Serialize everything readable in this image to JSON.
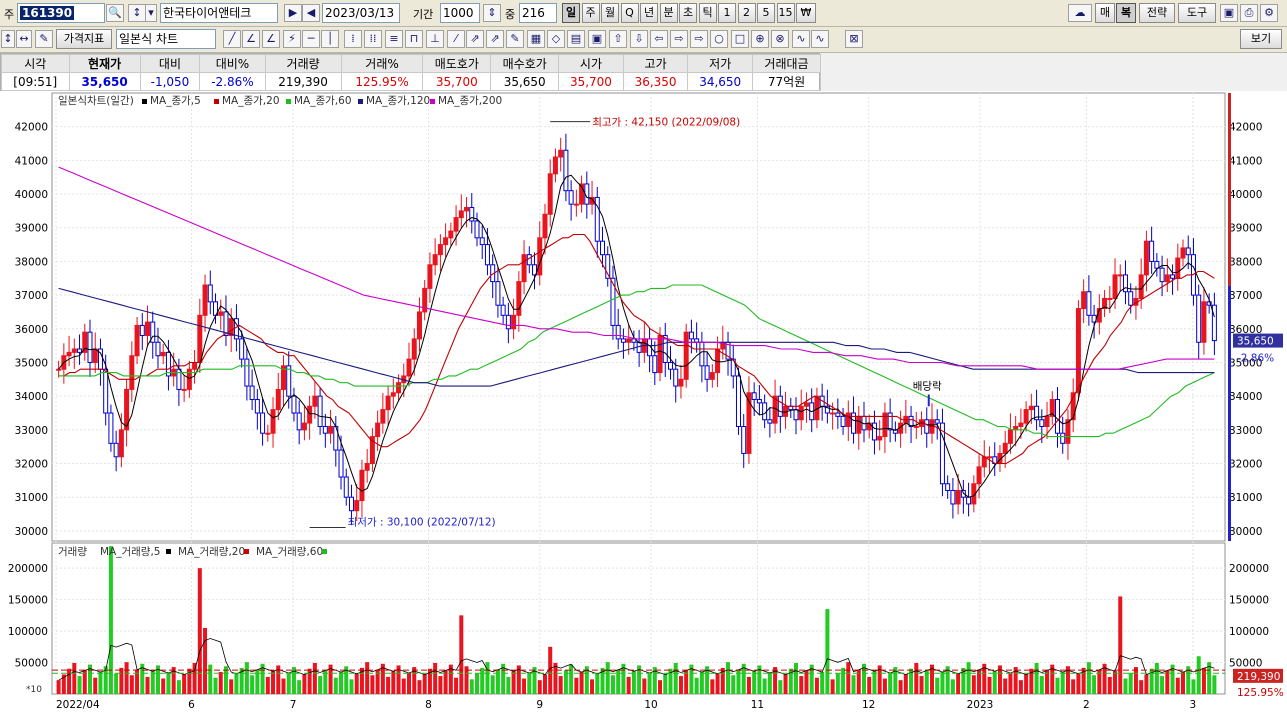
{
  "toolbar": {
    "code_prefix": "주",
    "code": "161390",
    "stock_name": "한국타이어앤테크",
    "date": "2023/03/13",
    "period_label": "기간",
    "period_value": "1000",
    "count_label": "중",
    "count_value": "216",
    "timeframes": [
      "일",
      "주",
      "월",
      "Q",
      "년",
      "분",
      "초",
      "틱",
      "1",
      "2",
      "5",
      "15",
      "₩"
    ],
    "active_timeframe": "일",
    "right_buttons": [
      "매",
      "복",
      "전략",
      "도구"
    ],
    "indicator_button": "가격지표",
    "chart_type": "일본식 차트",
    "view_button": "보기"
  },
  "quote": {
    "headers": [
      "시각",
      "현재가",
      "대비",
      "대비%",
      "거래량",
      "거래%",
      "매도호가",
      "매수호가",
      "시가",
      "고가",
      "저가",
      "거래대금"
    ],
    "values": [
      "[09:51]",
      "35,650",
      "-1,050",
      "-2.86%",
      "219,390",
      "125.95%",
      "35,700",
      "35,650",
      "35,700",
      "36,350",
      "34,650",
      "77억원"
    ]
  },
  "colors": {
    "up": "#e8141e",
    "down": "#0000cc",
    "ma5": "#000000",
    "ma20": "#c00000",
    "ma60": "#22bb22",
    "ma120": "#1a1a80",
    "ma200": "#cc00cc",
    "vol_up": "#e8141e",
    "vol_down": "#22cc22"
  },
  "chart_data": [
    {
      "type": "candlestick",
      "title": "일본식차트(일간)",
      "legend": [
        "MA_종가,5",
        "MA_종가,20",
        "MA_종가,60",
        "MA_종가,120",
        "MA_종가,200"
      ],
      "ylim": [
        29700,
        43000
      ],
      "yticks": [
        30000,
        31000,
        32000,
        33000,
        34000,
        35000,
        36000,
        37000,
        38000,
        39000,
        40000,
        41000,
        42000
      ],
      "xlabels": [
        "2022/04",
        "6",
        "7",
        "8",
        "9",
        "10",
        "11",
        "12",
        "2023",
        "2",
        "3"
      ],
      "last_price": "35,650",
      "last_change": "-2.86%",
      "annotations": [
        {
          "text": "최고가 : 42,150 (2022/09/08)",
          "value": 42150
        },
        {
          "text": "최저가 : 30,100 (2022/07/12)",
          "value": 30100
        },
        {
          "text": "배당락"
        }
      ],
      "closes": [
        34800,
        35200,
        35300,
        35400,
        35300,
        35900,
        35000,
        35400,
        34800,
        33500,
        32600,
        32200,
        33000,
        34200,
        35200,
        36100,
        35800,
        36200,
        35600,
        35200,
        35300,
        34600,
        34800,
        34200,
        34200,
        34800,
        35000,
        36400,
        37300,
        36800,
        36400,
        36500,
        35800,
        36300,
        35700,
        35100,
        34300,
        33900,
        33500,
        32900,
        32900,
        33600,
        34200,
        34900,
        34000,
        33500,
        33000,
        33200,
        33700,
        34000,
        33100,
        32900,
        33100,
        32400,
        31600,
        31000,
        30600,
        30900,
        31800,
        32000,
        32800,
        33200,
        33600,
        34000,
        34100,
        34400,
        34600,
        35100,
        35700,
        36500,
        37200,
        37900,
        38200,
        38500,
        38700,
        38900,
        39300,
        39500,
        39600,
        39200,
        38700,
        38500,
        37900,
        37400,
        36700,
        36400,
        36000,
        36400,
        37400,
        38200,
        37900,
        37600,
        38700,
        39400,
        40600,
        41100,
        41300,
        40100,
        39700,
        39700,
        40300,
        39700,
        39900,
        38600,
        38200,
        37500,
        36100,
        35700,
        35600,
        35700,
        35600,
        35300,
        35700,
        35200,
        34700,
        35800,
        35000,
        34800,
        34300,
        34500,
        35900,
        35700,
        35600,
        34900,
        34500,
        34700,
        35400,
        35600,
        35100,
        34600,
        33100,
        32300,
        34100,
        33900,
        33800,
        33300,
        33200,
        34000,
        33400,
        33700,
        33600,
        33300,
        33700,
        33800,
        33300,
        34000,
        33700,
        33500,
        33500,
        33400,
        33100,
        33500,
        32900,
        33400,
        33000,
        33200,
        32700,
        32800,
        33500,
        33000,
        32900,
        33200,
        33400,
        33100,
        33100,
        33300,
        32900,
        33300,
        33200,
        31400,
        31200,
        30800,
        31200,
        31000,
        30800,
        31400,
        31900,
        32200,
        32200,
        32000,
        32300,
        32600,
        33000,
        33100,
        33200,
        33600,
        33700,
        33300,
        33100,
        33400,
        33900,
        32900,
        32600,
        33300,
        34100,
        36600,
        37100,
        36400,
        36200,
        36600,
        36900,
        36900,
        37600,
        37600,
        37100,
        36700,
        36900,
        37600,
        38600,
        38000,
        37800,
        37400,
        37600,
        37500,
        38100,
        38400,
        38200,
        37000,
        35600,
        36800,
        36700,
        35650
      ],
      "ma20": [
        34600,
        34600,
        34700,
        34700,
        34800,
        34800,
        34800,
        34800,
        34800,
        34700,
        34600,
        34500,
        34500,
        34500,
        34500,
        34600,
        34600,
        34700,
        34800,
        34800,
        34800,
        34900,
        34900,
        34900,
        35000,
        35000,
        35000,
        35300,
        35500,
        35700,
        35800,
        35900,
        36000,
        36100,
        36000,
        35900,
        35800,
        35700,
        35500,
        35400,
        35300,
        35300,
        35200,
        35200,
        35000,
        34800,
        34600,
        34400,
        34200,
        34000,
        33900,
        33700,
        33600,
        33500,
        33300,
        33100,
        32900,
        32700,
        32600,
        32500,
        32500,
        32600,
        32700,
        32800,
        32900,
        33100,
        33300,
        33600,
        34000,
        34400,
        34800,
        35200,
        35600,
        36000,
        36300,
        36600,
        36900,
        37200,
        37400,
        37600,
        37700,
        37800,
        37900,
        37900,
        37900,
        38000,
        38100,
        38200,
        38300,
        38400,
        38500,
        38600,
        38700,
        38700,
        38800,
        38800,
        38800,
        38600,
        38300,
        38000,
        37700,
        37400,
        37100,
        36800,
        36600,
        36400,
        36300,
        36200,
        36000,
        35900,
        35800,
        35700,
        35600,
        35500,
        35500,
        35500,
        35400,
        35400,
        35400,
        35400,
        35400,
        35300,
        35200,
        35100,
        34900,
        34800,
        34700,
        34600,
        34400,
        34200,
        34000,
        33900,
        33800,
        33700,
        33700,
        33700,
        33800,
        33900,
        34000,
        33900,
        33800,
        33700,
        33600,
        33500,
        33400,
        33400,
        33400,
        33400,
        33400,
        33400,
        33400,
        33400,
        33400,
        33400,
        33300,
        33300,
        33300,
        33200,
        33200,
        33100,
        33100,
        33000,
        32900,
        32800,
        32700,
        32600,
        32500,
        32400,
        32300,
        32200,
        32100,
        32000,
        32000,
        32000,
        32100,
        32200,
        32300,
        32500,
        32600,
        32700,
        32800,
        33000,
        33200,
        33400,
        33600,
        33900,
        34200,
        34500,
        34800,
        35100,
        35300,
        35500,
        35800,
        36000,
        36200,
        36500,
        36700,
        36800,
        36900,
        37000,
        37100,
        37200,
        37300,
        37400,
        37500,
        37500,
        37600,
        37600,
        37700,
        37700,
        37600,
        37500
      ],
      "ma60": [
        34600,
        34600,
        34600,
        34600,
        34600,
        34600,
        34700,
        34700,
        34700,
        34600,
        34600,
        34600,
        34600,
        34600,
        34600,
        34700,
        34700,
        34700,
        34700,
        34700,
        34800,
        34800,
        34800,
        34800,
        34800,
        34900,
        34900,
        34900,
        34900,
        34900,
        34900,
        34800,
        34800,
        34700,
        34700,
        34600,
        34600,
        34500,
        34500,
        34400,
        34400,
        34300,
        34300,
        34300,
        34300,
        34300,
        34300,
        34300,
        34300,
        34400,
        34400,
        34400,
        34500,
        34500,
        34600,
        34600,
        34700,
        34800,
        34800,
        34900,
        35000,
        35100,
        35200,
        35300,
        35400,
        35600,
        35700,
        35900,
        36000,
        36100,
        36200,
        36300,
        36400,
        36500,
        36600,
        36700,
        36800,
        36900,
        37000,
        37000,
        37100,
        37100,
        37200,
        37200,
        37200,
        37300,
        37300,
        37300,
        37300,
        37300,
        37200,
        37100,
        37000,
        36900,
        36800,
        36700,
        36500,
        36300,
        36200,
        36100,
        36000,
        35900,
        35800,
        35700,
        35600,
        35500,
        35400,
        35300,
        35200,
        35100,
        35000,
        34900,
        34800,
        34700,
        34600,
        34500,
        34400,
        34300,
        34200,
        34100,
        34000,
        33900,
        33800,
        33700,
        33600,
        33500,
        33400,
        33300,
        33300,
        33200,
        33100,
        33100,
        33000,
        33000,
        33000,
        32900,
        32900,
        32800,
        32800,
        32800,
        32800,
        32800,
        32800,
        32800,
        32800,
        32900,
        32900,
        33000,
        33100,
        33200,
        33300,
        33400,
        33600,
        33800,
        34000,
        34100,
        34300,
        34400,
        34500,
        34600,
        34700
      ],
      "ma120": [
        37200,
        37100,
        37000,
        36900,
        36800,
        36700,
        36600,
        36500,
        36400,
        36300,
        36200,
        36100,
        36000,
        35900,
        35800,
        35700,
        35600,
        35500,
        35400,
        35300,
        35200,
        35100,
        35000,
        34900,
        34800,
        34700,
        34600,
        34500,
        34400,
        34400,
        34300,
        34300,
        34300,
        34300,
        34300,
        34400,
        34500,
        34600,
        34700,
        34800,
        34900,
        35000,
        35100,
        35200,
        35300,
        35400,
        35500,
        35500,
        35600,
        35600,
        35600,
        35600,
        35600,
        35600,
        35600,
        35600,
        35600,
        35600,
        35600,
        35600,
        35600,
        35600,
        35500,
        35500,
        35400,
        35400,
        35300,
        35300,
        35200,
        35100,
        35000,
        34900,
        34800,
        34800,
        34800,
        34800,
        34800,
        34800,
        34800,
        34800,
        34800,
        34800,
        34800,
        34800,
        34800,
        34700,
        34700,
        34700,
        34700,
        34700,
        34700,
        34700
      ],
      "ma200": [
        40800,
        40600,
        40400,
        40200,
        40000,
        39800,
        39600,
        39400,
        39200,
        39000,
        38800,
        38600,
        38400,
        38200,
        38000,
        37800,
        37600,
        37400,
        37200,
        37000,
        36900,
        36800,
        36700,
        36600,
        36500,
        36400,
        36300,
        36200,
        36100,
        36100,
        36000,
        36000,
        35900,
        35900,
        35800,
        35800,
        35700,
        35700,
        35700,
        35600,
        35600,
        35600,
        35500,
        35500,
        35500,
        35400,
        35400,
        35300,
        35300,
        35200,
        35200,
        35100,
        35100,
        35000,
        35000,
        35000,
        34900,
        34900,
        34900,
        34900,
        34900,
        34800,
        34800,
        34800,
        34800,
        34800,
        34800,
        34900,
        35000,
        35100,
        35100,
        35100,
        35100
      ]
    },
    {
      "type": "bar",
      "title": "거래량",
      "legend": [
        "MA_거래량,5",
        "MA_거래량,20",
        "MA_거래량,60"
      ],
      "ylim": [
        0,
        240000
      ],
      "yticks": [
        50000,
        100000,
        150000,
        200000
      ],
      "unit_label": "*10",
      "last_volume": "219,390",
      "last_ratio": "125.95%",
      "spikes": [
        {
          "index": 10,
          "value": 235000
        },
        {
          "index": 27,
          "value": 200000
        },
        {
          "index": 28,
          "value": 105000
        },
        {
          "index": 77,
          "value": 125000
        },
        {
          "index": 94,
          "value": 75000
        },
        {
          "index": 147,
          "value": 135000
        },
        {
          "index": 203,
          "value": 155000
        },
        {
          "index": 218,
          "value": 60000
        }
      ]
    }
  ]
}
